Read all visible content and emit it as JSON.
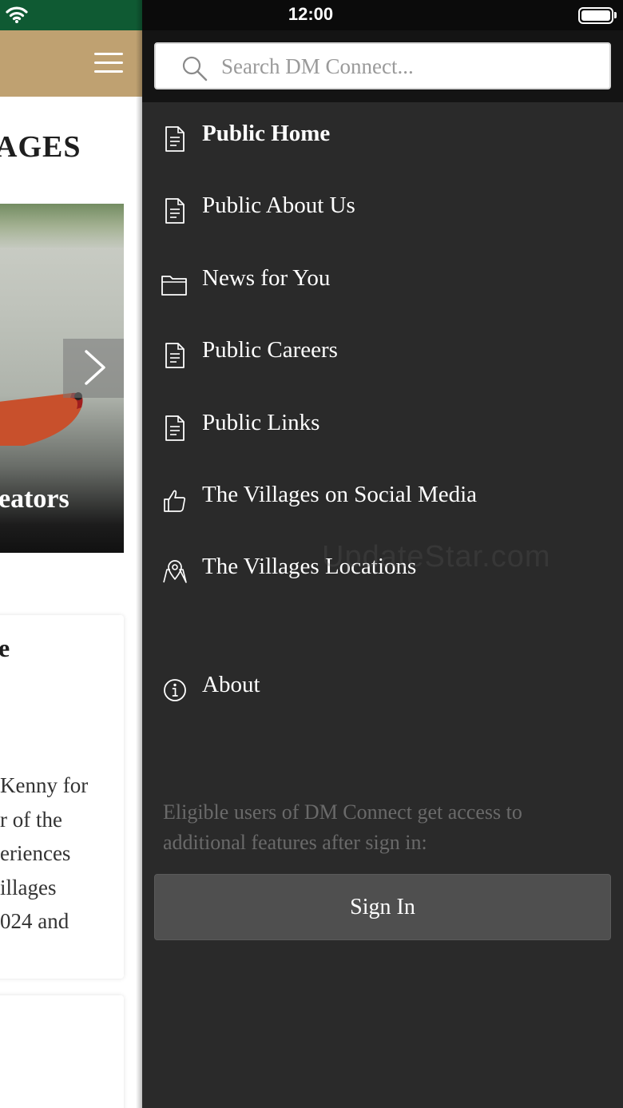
{
  "status_bar": {
    "time": "12:00"
  },
  "background_page": {
    "title_fragment": "AGES",
    "hero_caption_fragment": "eators",
    "card_title_fragment": "e",
    "card_text_fragments": [
      "Kenny for",
      "r of the",
      "eriences",
      "illages",
      "024 and"
    ]
  },
  "search": {
    "placeholder": "Search DM Connect..."
  },
  "menu": {
    "items": [
      {
        "label": "Public Home",
        "icon": "document-icon",
        "active": true
      },
      {
        "label": "Public About Us",
        "icon": "document-icon"
      },
      {
        "label": "News for You",
        "icon": "folder-icon"
      },
      {
        "label": "Public Careers",
        "icon": "document-icon"
      },
      {
        "label": "Public Links",
        "icon": "document-icon"
      },
      {
        "label": "The Villages on Social Media",
        "icon": "thumbs-up-icon"
      },
      {
        "label": "The Villages Locations",
        "icon": "map-pin-icon"
      }
    ],
    "about": {
      "label": "About",
      "icon": "info-icon"
    }
  },
  "watermark": "UpdateStar.com",
  "sign_in": {
    "note": "Eligible users of DM Connect get access to additional features after sign in:",
    "button_label": "Sign In"
  },
  "colors": {
    "status_bar_left": "#0f5a33",
    "header_gold": "#bfa171",
    "drawer_background": "#2a2a2a",
    "search_area": "#141414",
    "sign_in_button": "#4f4f4f"
  }
}
